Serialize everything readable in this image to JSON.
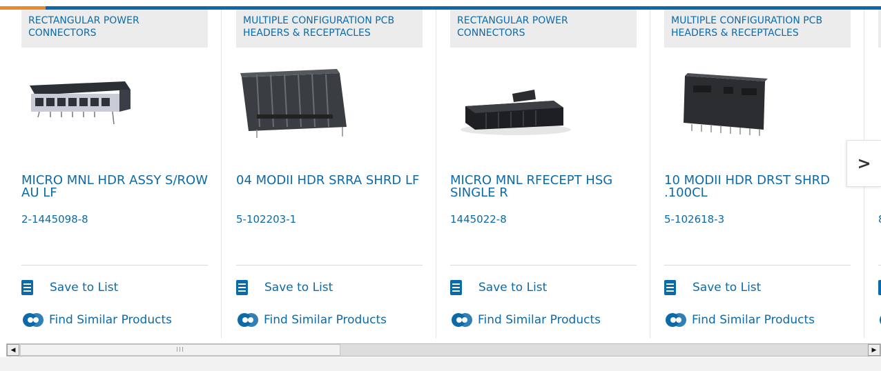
{
  "colors": {
    "brand_blue": "#0d6aa8",
    "accent_orange": "#e88b2a"
  },
  "cards": [
    {
      "category": "RECTANGULAR POWER CONNECTORS",
      "title": "MICRO MNL HDR ASSY S/ROW AU LF",
      "part_number": "2-1445098-8",
      "save_label": "Save to List",
      "find_label": "Find Similar Products"
    },
    {
      "category": "MULTIPLE CONFIGURATION PCB HEADERS & RECEPTACLES",
      "title": "04 MODII HDR SRRA SHRD LF",
      "part_number": "5-102203-1",
      "save_label": "Save to List",
      "find_label": "Find Similar Products"
    },
    {
      "category": "RECTANGULAR POWER CONNECTORS",
      "title": "MICRO MNL RFECEPT HSG SINGLE R",
      "part_number": "1445022-8",
      "save_label": "Save to List",
      "find_label": "Find Similar Products"
    },
    {
      "category": "MULTIPLE CONFIGURATION PCB HEADERS & RECEPTACLES",
      "title": "10 MODII HDR DRST SHRD .100CL",
      "part_number": "5-102618-3",
      "save_label": "Save to List",
      "find_label": "Find Similar Products"
    },
    {
      "category": "",
      "title": "",
      "part_number": "8",
      "save_label": "",
      "find_label": ""
    }
  ],
  "carousel": {
    "next_icon": "chevron-right-icon",
    "next_glyph": ">"
  },
  "scrollbar": {
    "left_glyph": "◀",
    "right_glyph": "▶",
    "thumb_grip": "III"
  }
}
